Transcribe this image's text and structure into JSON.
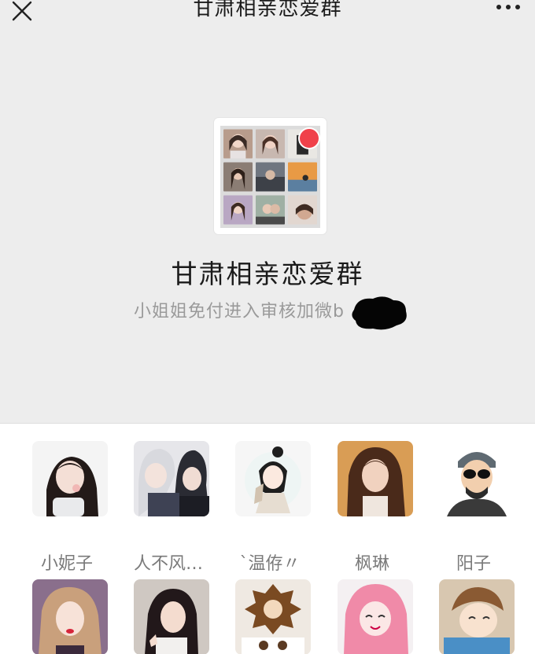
{
  "nav": {
    "title": "甘肃相亲恋爱群",
    "close_icon": "close-icon",
    "more_icon": "more-icon"
  },
  "group": {
    "name": "甘肃相亲恋爱群",
    "description": "小姐姐免付进入审核加微b",
    "badge_color": "#f0414a"
  },
  "members": {
    "row1": [
      {
        "name": "小妮子"
      },
      {
        "name": "人不风…"
      },
      {
        "name": "`温侟〃"
      },
      {
        "name": "枫琳"
      },
      {
        "name": "阳子"
      }
    ]
  }
}
